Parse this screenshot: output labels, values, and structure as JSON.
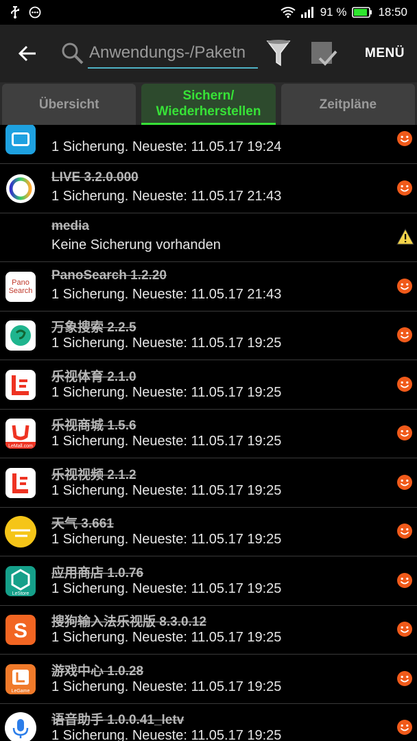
{
  "status_bar": {
    "battery_percent": "91 %",
    "time": "18:50",
    "icons": [
      "usb-icon",
      "chat-icon",
      "wifi-icon",
      "signal-icon",
      "battery-icon"
    ],
    "battery_level": 0.91
  },
  "action_bar": {
    "search_placeholder": "Anwendungs-/Paketn",
    "menu_label": "MENÜ"
  },
  "tabs": [
    {
      "label": "Übersicht",
      "active": false
    },
    {
      "label": "Sichern/\nWiederherstellen",
      "active": true
    },
    {
      "label": "Zeitpläne",
      "active": false
    }
  ],
  "rows": [
    {
      "title": "",
      "subtitle": "1 Sicherung. Neueste: 11.05.17 19:24",
      "icon": "letv-blue-icon",
      "status": "smiley"
    },
    {
      "title": "LIVE 3.2.0.000",
      "subtitle": "1 Sicherung. Neueste: 11.05.17 21:43",
      "icon": "live-ring-icon",
      "status": "smiley"
    },
    {
      "title": "media",
      "subtitle": "Keine Sicherung vorhanden",
      "icon": "",
      "status": "warning"
    },
    {
      "title": "PanoSearch 1.2.20",
      "subtitle": "1 Sicherung. Neueste: 11.05.17 21:43",
      "icon": "panosearch-icon",
      "status": "smiley",
      "icon_text": "Pano\nSearch"
    },
    {
      "title": "万象搜索 2.2.5",
      "subtitle": "1 Sicherung. Neueste: 11.05.17 19:25",
      "icon": "wanxiang-icon",
      "status": "smiley"
    },
    {
      "title": "乐视体育 2.1.0",
      "subtitle": "1 Sicherung. Neueste: 11.05.17 19:25",
      "icon": "letv-sports-icon",
      "status": "smiley"
    },
    {
      "title": "乐视商城 1.5.6",
      "subtitle": "1 Sicherung. Neueste: 11.05.17 19:25",
      "icon": "lemall-icon",
      "status": "smiley",
      "icon_text": "LeMall.com"
    },
    {
      "title": "乐视视频 2.1.2",
      "subtitle": "1 Sicherung. Neueste: 11.05.17 19:25",
      "icon": "letv-video-icon",
      "status": "smiley"
    },
    {
      "title": "天气 3.661",
      "subtitle": "1 Sicherung. Neueste: 11.05.17 19:25",
      "icon": "weather-icon",
      "status": "smiley"
    },
    {
      "title": "应用商店 1.0.76",
      "subtitle": "1 Sicherung. Neueste: 11.05.17 19:25",
      "icon": "lestore-icon",
      "status": "smiley",
      "icon_text": "LeStore"
    },
    {
      "title": "搜狗输入法乐视版 8.3.0.12",
      "subtitle": "1 Sicherung. Neueste: 11.05.17 19:25",
      "icon": "sogou-icon",
      "status": "smiley"
    },
    {
      "title": "游戏中心 1.0.28",
      "subtitle": "1 Sicherung. Neueste: 11.05.17 19:25",
      "icon": "legame-icon",
      "status": "smiley",
      "icon_text": "LeGame"
    },
    {
      "title": "语音助手 1.0.0.41_letv",
      "subtitle": "1 Sicherung. Neueste: 11.05.17 19:25",
      "icon": "voice-assistant-icon",
      "status": "smiley"
    }
  ]
}
